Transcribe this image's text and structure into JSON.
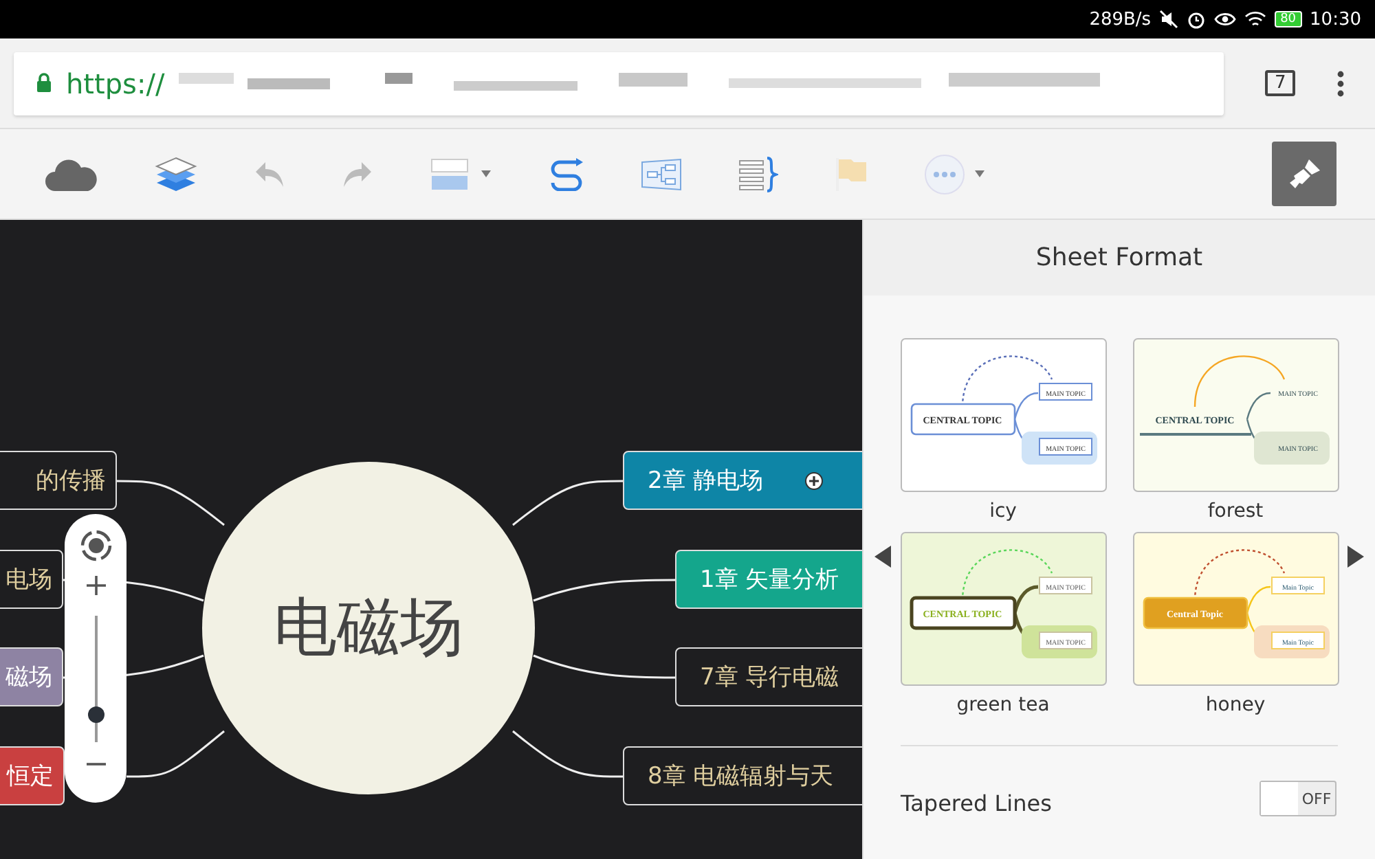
{
  "status_bar": {
    "speed": "289B/s",
    "battery": "80",
    "time": "10:30"
  },
  "browser": {
    "url": "https://",
    "tab_count": "7"
  },
  "mind_map": {
    "central": "电磁场",
    "zoom": {
      "level": 0.25
    },
    "branches": [
      {
        "label": "的传播",
        "color": "#1e1e20"
      },
      {
        "label": "电场",
        "color": "#1e1e20"
      },
      {
        "label": "磁场",
        "color": "#8e83a3"
      },
      {
        "label": "恒定",
        "color": "#c94040"
      },
      {
        "label": "2章 静电场",
        "color": "#0e85a6",
        "expandable": true
      },
      {
        "label": "1章 矢量分析",
        "color": "#14a68c",
        "expandable": false
      },
      {
        "label": "7章 导行电磁",
        "color": "#1e1e20",
        "expandable": false
      },
      {
        "label": "8章 电磁辐射与天",
        "color": "#1e1e20",
        "expandable": false
      }
    ]
  },
  "panel": {
    "title": "Sheet Format",
    "themes": [
      {
        "name": "icy",
        "kind": "icy",
        "central": "CENTRAL TOPIC",
        "topics": [
          "MAIN TOPIC",
          "MAIN TOPIC"
        ],
        "selected": false
      },
      {
        "name": "forest",
        "kind": "forest",
        "central": "CENTRAL TOPIC",
        "topics": [
          "MAIN TOPIC",
          "MAIN TOPIC"
        ],
        "selected": false
      },
      {
        "name": "green tea",
        "kind": "greentea",
        "central": "CENTRAL TOPIC",
        "topics": [
          "MAIN TOPIC",
          "MAIN TOPIC"
        ],
        "selected": false
      },
      {
        "name": "honey",
        "kind": "honey",
        "central": "Central Topic",
        "topics": [
          "Main Topic",
          "Main Topic"
        ],
        "selected": false
      }
    ],
    "toggle": {
      "label": "Tapered Lines",
      "on": false,
      "state_text": "OFF"
    }
  }
}
